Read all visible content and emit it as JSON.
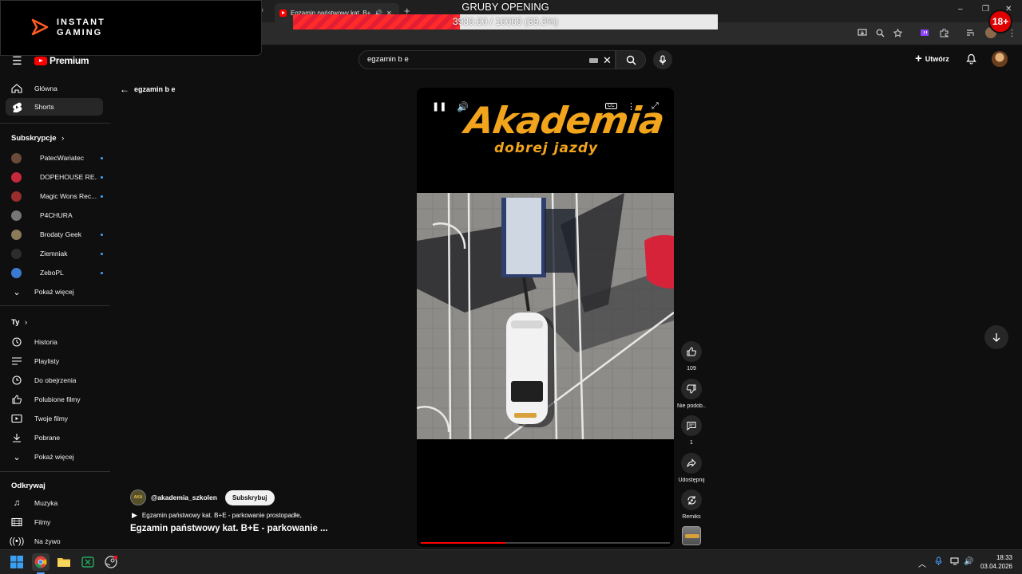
{
  "browser": {
    "tab_title": "Egzamin państwowy kat. B+E",
    "new_tab_symbol": "+",
    "minimize": "–",
    "restore": "❐",
    "close": "✕"
  },
  "overlay": {
    "brand_line1": "INSTANT",
    "brand_line2": "GAMING",
    "goal_title": "GRUBY OPENING",
    "goal_text": "3930.00 / 10000 (39.3%)",
    "goal_fraction": 0.393,
    "age_badge": "18+",
    "accent_color": "#ff2b2b"
  },
  "youtube": {
    "brand": "Premium",
    "search_value": "egzamin b e",
    "create_label": "Utwórz",
    "brand_color": "#ff0000"
  },
  "sidebar": {
    "main": [
      {
        "label": "Główna",
        "icon": "home-icon"
      },
      {
        "label": "Shorts",
        "icon": "shorts-icon",
        "active": true
      }
    ],
    "subs_title": "Subskrypcje",
    "subs": [
      {
        "label": "PatecWariatec",
        "color": "#6b4a3a",
        "dot": true
      },
      {
        "label": "DOPEHOUSE RE...",
        "color": "#c8283c",
        "dot": true
      },
      {
        "label": "Magic Wons Rec...",
        "color": "#9a2d2d",
        "dot": true
      },
      {
        "label": "P4CHURA",
        "color": "#777777",
        "dot": false
      },
      {
        "label": "Brodaty Geek",
        "color": "#8a7a5a",
        "dot": true
      },
      {
        "label": "Ziemniak",
        "color": "#2d2d2d",
        "dot": true
      },
      {
        "label": "ZeboPL",
        "color": "#3a7ad0",
        "dot": true
      }
    ],
    "show_more": "Pokaż więcej",
    "you_title": "Ty",
    "you": [
      {
        "label": "Historia",
        "icon": "history-icon"
      },
      {
        "label": "Playlisty",
        "icon": "playlists-icon"
      },
      {
        "label": "Do obejrzenia",
        "icon": "watch-later-icon"
      },
      {
        "label": "Polubione filmy",
        "icon": "liked-icon"
      },
      {
        "label": "Twoje filmy",
        "icon": "your-videos-icon"
      },
      {
        "label": "Pobrane",
        "icon": "downloads-icon"
      }
    ],
    "show_more_2": "Pokaż więcej",
    "explore_title": "Odkrywaj",
    "explore": [
      {
        "label": "Muzyka",
        "icon": "music-icon"
      },
      {
        "label": "Filmy",
        "icon": "movies-icon"
      },
      {
        "label": "Na żywo",
        "icon": "live-icon"
      }
    ]
  },
  "shorts": {
    "back_label": "egzamin b e",
    "logo_title": "Akademia",
    "logo_subtitle": "dobrej jazdy",
    "logo_color": "#f2a51c",
    "progress_fraction": 0.34,
    "channel_handle": "@akademia_szkolen",
    "subscribe_label": "Subskrybuj",
    "related_text": "Egzamin państwowy kat. B+E - parkowanie prostopadłe,",
    "title": "Egzamin państwowy kat. B+E - parkowanie ...",
    "actions": {
      "like_count": "109",
      "dislike_label": "Nie podob...",
      "comments_count": "1",
      "share_label": "Udostępnij",
      "remix_label": "Remiks"
    }
  },
  "taskbar": {
    "time": "18:33",
    "date": "03.04.2026"
  }
}
